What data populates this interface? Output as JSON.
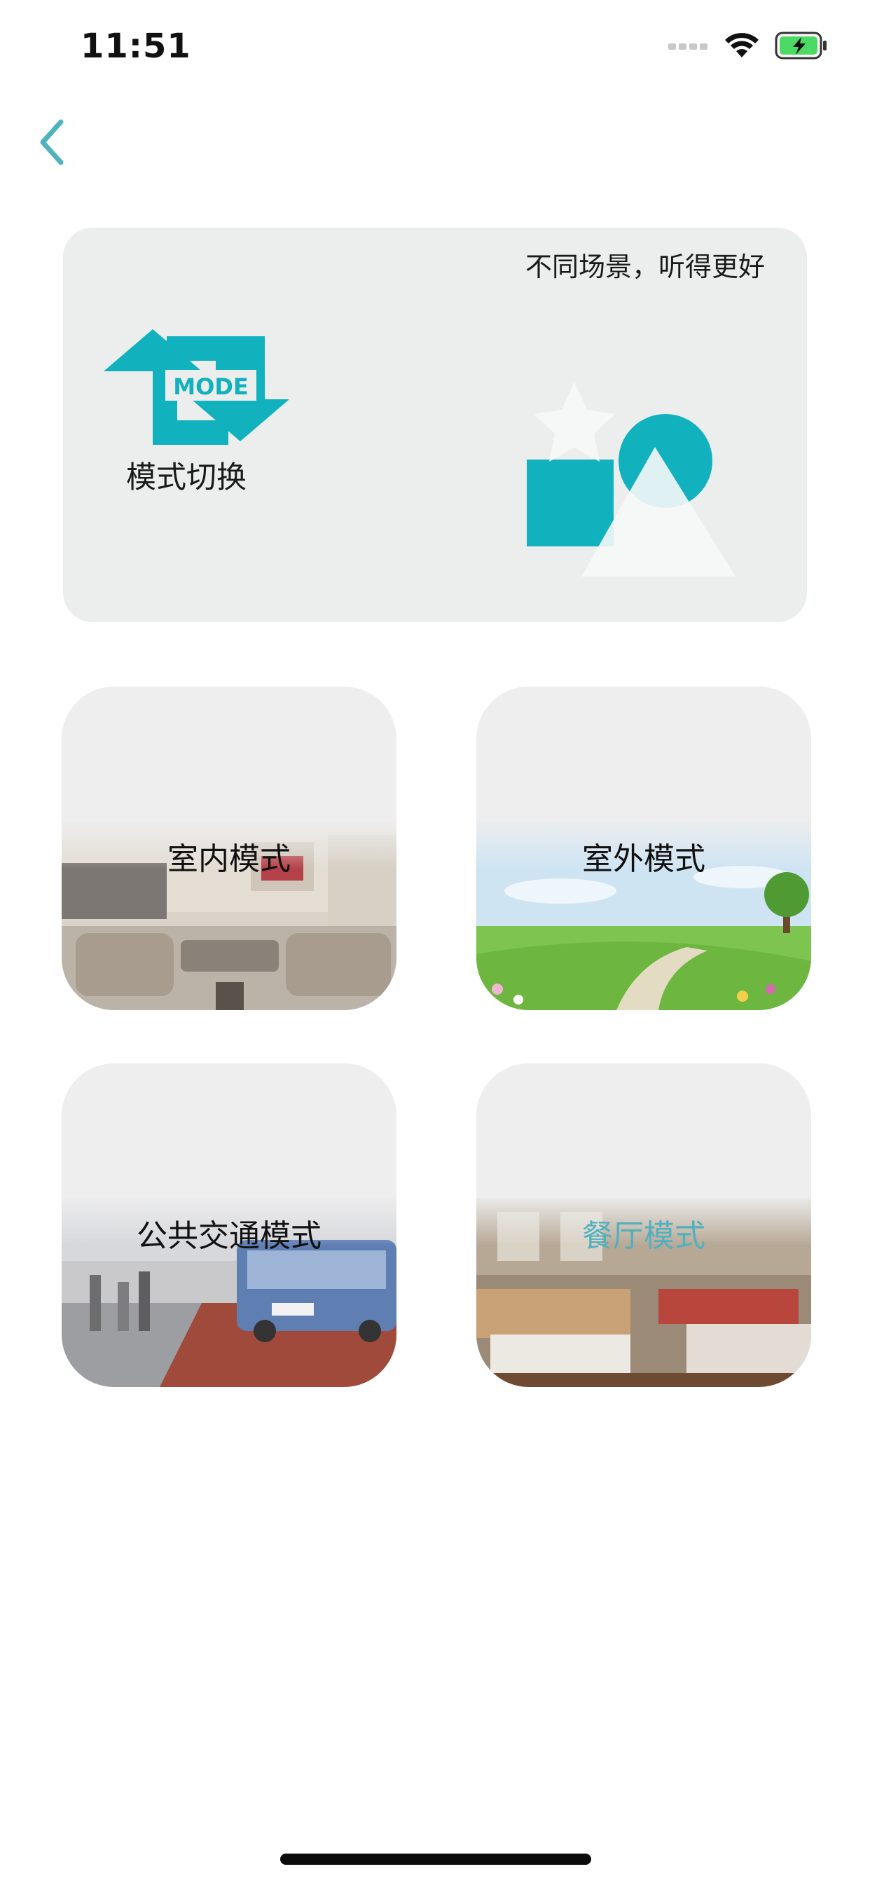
{
  "status_bar": {
    "time": "11:51"
  },
  "banner": {
    "slogan": "不同场景，听得更好",
    "mode_icon_text": "MODE",
    "label": "模式切换"
  },
  "modes": [
    {
      "label": "室内模式",
      "selected": false,
      "scene_icon": "living-room-scene"
    },
    {
      "label": "室外模式",
      "selected": false,
      "scene_icon": "meadow-scene"
    },
    {
      "label": "公共交通模式",
      "selected": false,
      "scene_icon": "bus-station-scene"
    },
    {
      "label": "餐厅模式",
      "selected": true,
      "scene_icon": "restaurant-scene"
    }
  ],
  "colors": {
    "accent": "#11b1be",
    "selected_text": "#52b0bd",
    "card_bg": "#eeeeee"
  }
}
